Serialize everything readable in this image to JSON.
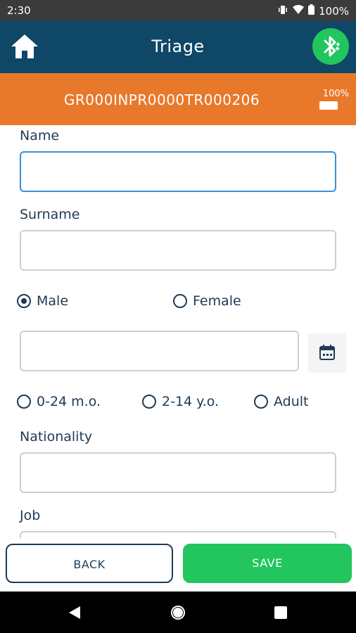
{
  "status_bar": {
    "time": "2:30",
    "battery": "100%"
  },
  "app_bar": {
    "title": "Triage"
  },
  "banner": {
    "code": "GR000INPR0000TR000206",
    "battery_percent": "100%"
  },
  "form": {
    "name_label": "Name",
    "name_value": "",
    "surname_label": "Surname",
    "surname_value": "",
    "gender": {
      "male": "Male",
      "female": "Female",
      "selected": "Male"
    },
    "dob_value": "",
    "age_groups": [
      "0-24 m.o.",
      "2-14 y.o.",
      "Adult"
    ],
    "nationality_label": "Nationality",
    "nationality_value": "",
    "job_label": "Job"
  },
  "actions": {
    "back": "BACK",
    "save": "SAVE"
  }
}
